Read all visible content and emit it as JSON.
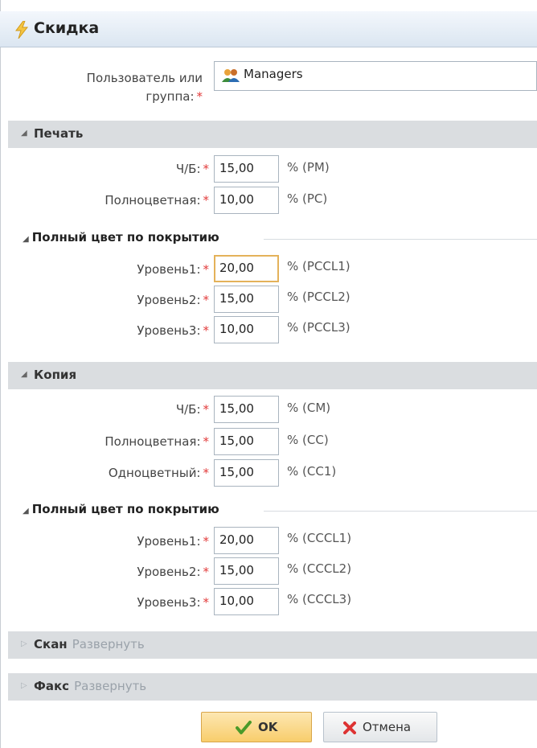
{
  "dialog": {
    "title": "Скидка"
  },
  "user_field": {
    "label_line1": "Пользователь или",
    "label_line2": "группа:",
    "required": "*",
    "value": "Managers"
  },
  "sections": {
    "print": {
      "title": "Печать",
      "bw": {
        "label": "Ч/Б:",
        "value": "15,00",
        "unit": "% (PM)"
      },
      "color": {
        "label": "Полноцветная:",
        "value": "10,00",
        "unit": "% (PC)"
      },
      "coverage": {
        "title": "Полный цвет по покрытию",
        "l1": {
          "label": "Уровень1:",
          "value": "20,00",
          "unit": "% (PCCL1)"
        },
        "l2": {
          "label": "Уровень2:",
          "value": "15,00",
          "unit": "% (PCCL2)"
        },
        "l3": {
          "label": "Уровень3:",
          "value": "10,00",
          "unit": "% (PCCL3)"
        }
      }
    },
    "copy": {
      "title": "Копия",
      "bw": {
        "label": "Ч/Б:",
        "value": "15,00",
        "unit": "% (CM)"
      },
      "color": {
        "label": "Полноцветная:",
        "value": "15,00",
        "unit": "% (CC)"
      },
      "single": {
        "label": "Одноцветный:",
        "value": "15,00",
        "unit": "% (CC1)"
      },
      "coverage": {
        "title": "Полный цвет по покрытию",
        "l1": {
          "label": "Уровень1:",
          "value": "20,00",
          "unit": "% (CCCL1)"
        },
        "l2": {
          "label": "Уровень2:",
          "value": "15,00",
          "unit": "% (CCCL2)"
        },
        "l3": {
          "label": "Уровень3:",
          "value": "10,00",
          "unit": "% (CCCL3)"
        }
      }
    },
    "scan": {
      "title": "Скан",
      "expand": "Развернуть"
    },
    "fax": {
      "title": "Факс",
      "expand": "Развернуть"
    }
  },
  "buttons": {
    "ok": "OK",
    "cancel": "Отмена"
  },
  "required_mark": "*"
}
